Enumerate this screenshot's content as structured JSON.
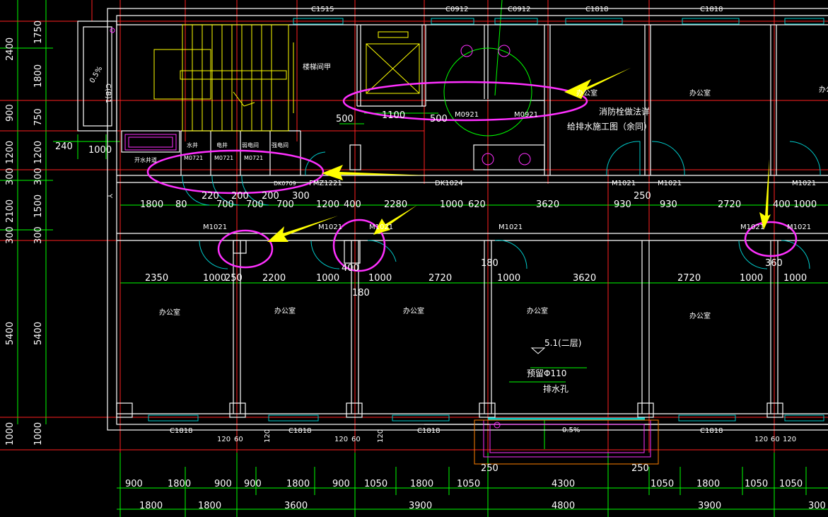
{
  "window": {
    "ordinate_labels": [
      "Y"
    ]
  },
  "colors": {
    "background": "#000000",
    "wall": "#ffffff",
    "axis": "#ff2020",
    "dimension": "#00ff00",
    "window": "#00c8c8",
    "door": "#00c8c8",
    "stair": "#ffff00",
    "highlight": "#ff30ff",
    "arrow": "#ffff00"
  },
  "window_tags": [
    "C1515",
    "C0912",
    "C0912",
    "C1818",
    "C1818",
    "C1818",
    "C1818",
    "C1818"
  ],
  "room_labels": {
    "stair": "楼梯间甲",
    "office_a": "办公室",
    "office_b": "办公室",
    "office_c": "办公室",
    "office_d": "办公室",
    "office_e": "办公室",
    "office_f": "办公室",
    "office_g": "办公室",
    "office_top_right": "办公室"
  },
  "door_tags": {
    "top": [
      "M0721",
      "M0721",
      "M0721",
      "M0921",
      "M0921"
    ],
    "utility": [
      "水井",
      "电井",
      "弱电间",
      "强电间"
    ],
    "hydrant": "开水井道",
    "fmz": "FMZ1221",
    "dk1": "DK0709",
    "dk2": "DK1024",
    "corridor_top": [
      "M1021",
      "M1021",
      "M1021"
    ],
    "corridor_bottom": [
      "M1021",
      "M1021",
      "M1021",
      "M1021",
      "M1021"
    ],
    "fifth": "M1021"
  },
  "notes": {
    "hydrant_1": "消防栓做法详",
    "hydrant_2": "给排水施工图（余同）",
    "level": "5.1(二层)",
    "pipe_1": "预留Φ110",
    "pipe_2": "排水孔",
    "slope_right": "0.5%",
    "slope_left": "0.5%",
    "opening": "C(B)1"
  },
  "dimensions": {
    "left_outer": [
      "2400",
      "900",
      "1200",
      "300",
      "2100",
      "300",
      "5400",
      "1000"
    ],
    "left_inner": [
      "1750",
      "1800",
      "750",
      "1200",
      "300",
      "1500",
      "300",
      "5400",
      "1000"
    ],
    "left_misc": [
      "240",
      "1000"
    ],
    "corridor": [
      "1800",
      "80",
      "220",
      "700",
      "200",
      "700",
      "200",
      "700",
      "300",
      "1200",
      "400",
      "2280",
      "1000",
      "620",
      "3620",
      "930",
      "250",
      "930",
      "2720",
      "400",
      "1000"
    ],
    "office_row": [
      "2350",
      "1000",
      "250",
      "2200",
      "1000",
      "400",
      "1000",
      "2720",
      "180",
      "1000",
      "3620",
      "2720",
      "360",
      "1000",
      "1000"
    ],
    "office_extra": [
      "180"
    ],
    "stair_dims": [
      "500",
      "1100",
      "500"
    ],
    "bottom_small": [
      "120",
      "60",
      "120",
      "120",
      "60",
      "120",
      "120",
      "60",
      "120"
    ],
    "bottom_250": [
      "250",
      "250"
    ],
    "bottom_row1": [
      "900",
      "1800",
      "900",
      "900",
      "1800",
      "900",
      "1050",
      "1800",
      "1050",
      "4300",
      "1050",
      "1800",
      "1050",
      "1050"
    ],
    "bottom_row2": [
      "1800",
      "1800",
      "3600",
      "3900",
      "4800",
      "3900",
      "300"
    ]
  }
}
